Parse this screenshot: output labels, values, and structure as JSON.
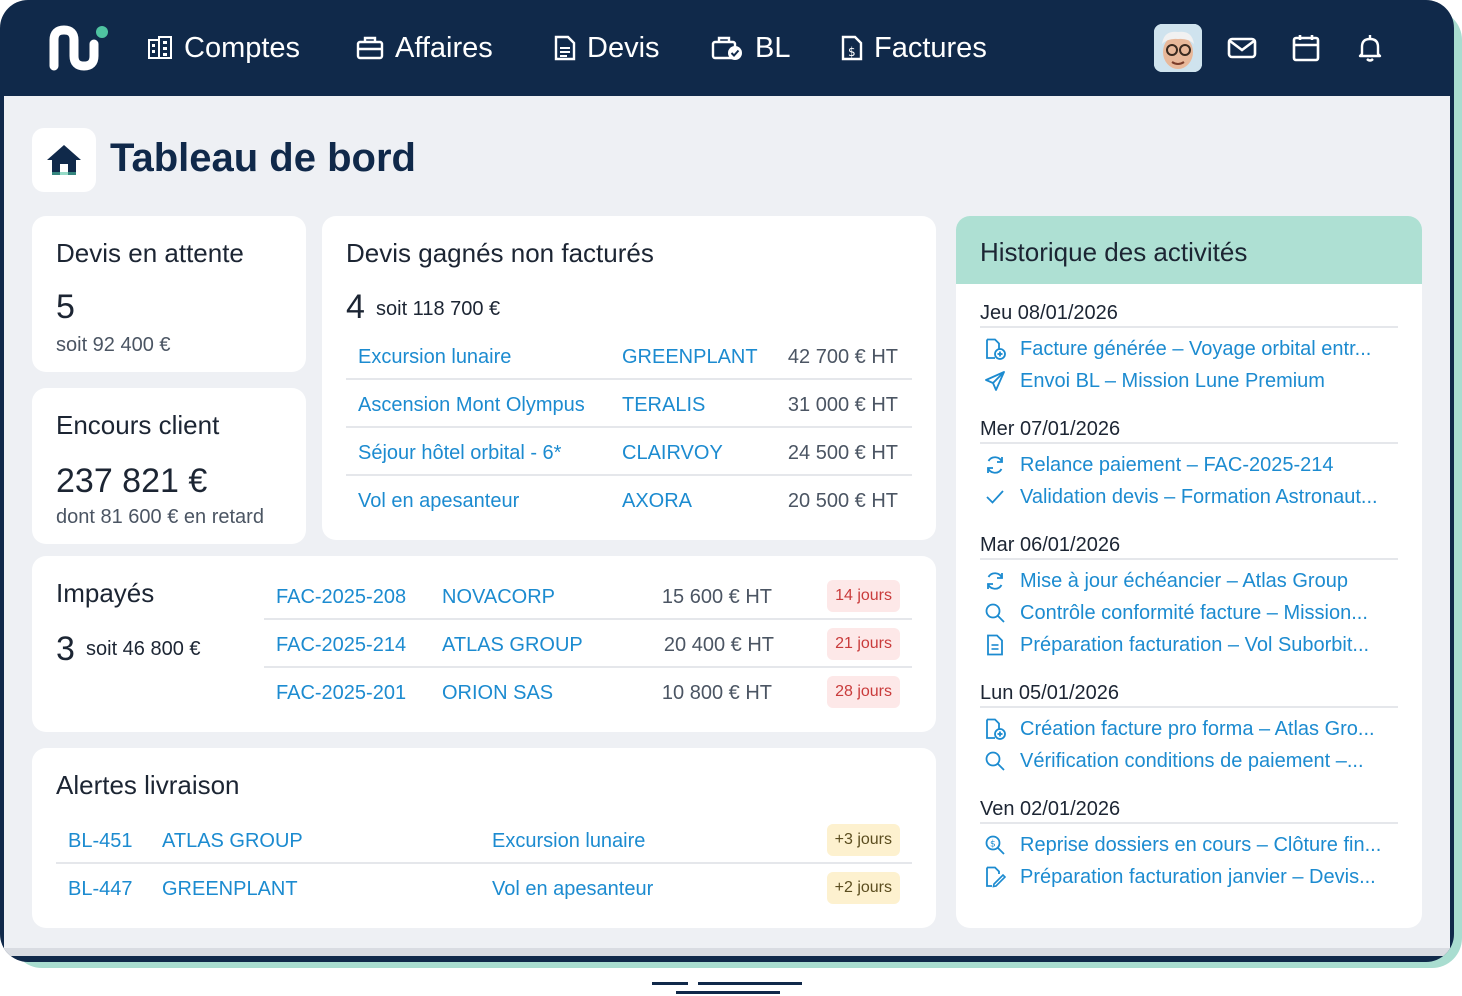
{
  "nav": {
    "items": [
      {
        "label": "Comptes",
        "icon": "building-icon"
      },
      {
        "label": "Affaires",
        "icon": "briefcase-icon"
      },
      {
        "label": "Devis",
        "icon": "document-icon"
      },
      {
        "label": "BL",
        "icon": "delivery-check-icon"
      },
      {
        "label": "Factures",
        "icon": "invoice-icon"
      }
    ],
    "right_icons": [
      "mail-icon",
      "calendar-icon",
      "bell-icon"
    ]
  },
  "header": {
    "title": "Tableau de bord",
    "icon": "home-icon"
  },
  "devis_attente": {
    "title": "Devis en attente",
    "count": "5",
    "sub": "soit 92 400 €"
  },
  "encours": {
    "title": "Encours client",
    "amount": "237 821 €",
    "sub": "dont 81 600 € en retard"
  },
  "devis_gagnes": {
    "title": "Devis gagnés non facturés",
    "count": "4",
    "sub": "soit 118 700 €",
    "rows": [
      {
        "name": "Excursion lunaire",
        "client": "GREENPLANT",
        "amount": "42 700 € HT"
      },
      {
        "name": "Ascension Mont Olympus",
        "client": "TERALIS",
        "amount": "31 000 € HT"
      },
      {
        "name": "Séjour hôtel orbital - 6*",
        "client": "CLAIRVOY",
        "amount": "24 500 € HT"
      },
      {
        "name": "Vol en apesanteur",
        "client": "AXORA",
        "amount": "20 500 € HT"
      }
    ]
  },
  "impayes": {
    "title": "Impayés",
    "count": "3",
    "sub": "soit 46 800 €",
    "rows": [
      {
        "ref": "FAC-2025-208",
        "client": "NOVACORP",
        "amount": "15 600 € HT",
        "delay": "14 jours"
      },
      {
        "ref": "FAC-2025-214",
        "client": "ATLAS GROUP",
        "amount": "20 400 € HT",
        "delay": "21 jours"
      },
      {
        "ref": "FAC-2025-201",
        "client": "ORION SAS",
        "amount": "10 800 € HT",
        "delay": "28 jours"
      }
    ]
  },
  "alertes": {
    "title": "Alertes livraison",
    "rows": [
      {
        "ref": "BL-451",
        "client": "ATLAS GROUP",
        "affaire": "Excursion lunaire",
        "delay": "+3 jours"
      },
      {
        "ref": "BL-447",
        "client": "GREENPLANT",
        "affaire": "Vol en apesanteur",
        "delay": "+2 jours"
      }
    ]
  },
  "historique": {
    "title": "Historique des activités",
    "days": [
      {
        "date": "Jeu 08/01/2026",
        "items": [
          {
            "icon": "file-plus-icon",
            "text": "Facture générée – Voyage orbital entr..."
          },
          {
            "icon": "send-icon",
            "text": "Envoi BL – Mission Lune Premium"
          }
        ]
      },
      {
        "date": "Mer 07/01/2026",
        "items": [
          {
            "icon": "refresh-icon",
            "text": "Relance paiement – FAC-2025-214"
          },
          {
            "icon": "check-icon",
            "text": "Validation devis – Formation Astronaut..."
          }
        ]
      },
      {
        "date": "Mar 06/01/2026",
        "items": [
          {
            "icon": "refresh-icon",
            "text": "Mise à jour échéancier – Atlas Group"
          },
          {
            "icon": "search-icon",
            "text": "Contrôle conformité facture – Mission..."
          },
          {
            "icon": "document-icon",
            "text": "Préparation facturation – Vol Suborbit..."
          }
        ]
      },
      {
        "date": "Lun 05/01/2026",
        "items": [
          {
            "icon": "file-plus-icon",
            "text": "Création facture pro forma – Atlas Gro..."
          },
          {
            "icon": "search-icon",
            "text": "Vérification conditions de paiement –..."
          }
        ]
      },
      {
        "date": "Ven 02/01/2026",
        "items": [
          {
            "icon": "search-money-icon",
            "text": "Reprise dossiers en cours – Clôture fin..."
          },
          {
            "icon": "signature-icon",
            "text": "Préparation facturation janvier – Devis..."
          }
        ]
      }
    ]
  }
}
